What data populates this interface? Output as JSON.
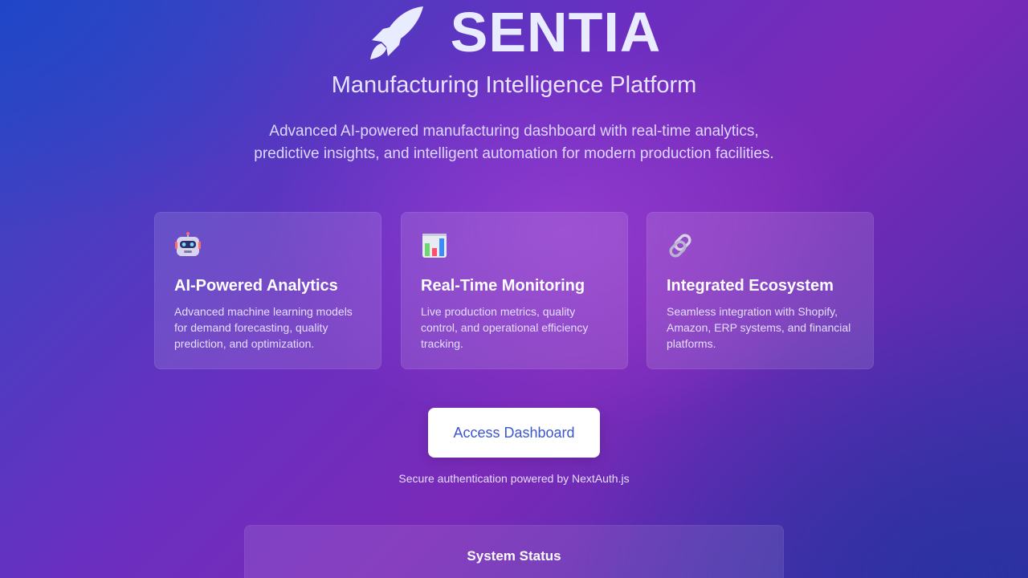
{
  "brand": {
    "name": "SENTIA",
    "icon": "rocket-icon"
  },
  "header": {
    "subtitle": "Manufacturing Intelligence Platform",
    "description": "Advanced AI-powered manufacturing dashboard with real-time analytics, predictive insights, and intelligent automation for modern production facilities."
  },
  "features": [
    {
      "icon": "robot-icon",
      "title": "AI-Powered Analytics",
      "text": "Advanced machine learning models for demand forecasting, quality prediction, and optimization."
    },
    {
      "icon": "bar-chart-icon",
      "title": "Real-Time Monitoring",
      "text": "Live production metrics, quality control, and operational efficiency tracking."
    },
    {
      "icon": "link-icon",
      "title": "Integrated Ecosystem",
      "text": "Seamless integration with Shopify, Amazon, ERP systems, and financial platforms."
    }
  ],
  "cta": {
    "label": "Access Dashboard",
    "note": "Secure authentication powered by NextAuth.js"
  },
  "status": {
    "title": "System Status"
  },
  "colors": {
    "accent": "#3b56cf",
    "brand_text": "#e9ecff"
  }
}
